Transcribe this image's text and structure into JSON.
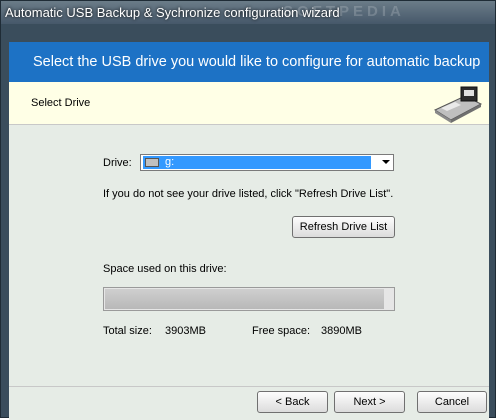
{
  "window": {
    "title": "Automatic USB Backup & Sychronize configuration wizard",
    "watermark": "SOFTPEDIA"
  },
  "banner": {
    "heading": "Select the USB drive you would like to configure for automatic backup"
  },
  "section": {
    "title": "Select Drive"
  },
  "drive": {
    "label": "Drive:",
    "selected": "g:",
    "hint": "If you do not see your drive listed, click \"Refresh Drive List\".",
    "refresh_button": "Refresh Drive List"
  },
  "space": {
    "label": "Space used on this drive:",
    "used_fraction": 0.0033,
    "total_label": "Total size:",
    "total_value": "3903MB",
    "free_label": "Free space:",
    "free_value": "3890MB"
  },
  "buttons": {
    "back": "< Back",
    "next": "Next >",
    "cancel": "Cancel"
  }
}
